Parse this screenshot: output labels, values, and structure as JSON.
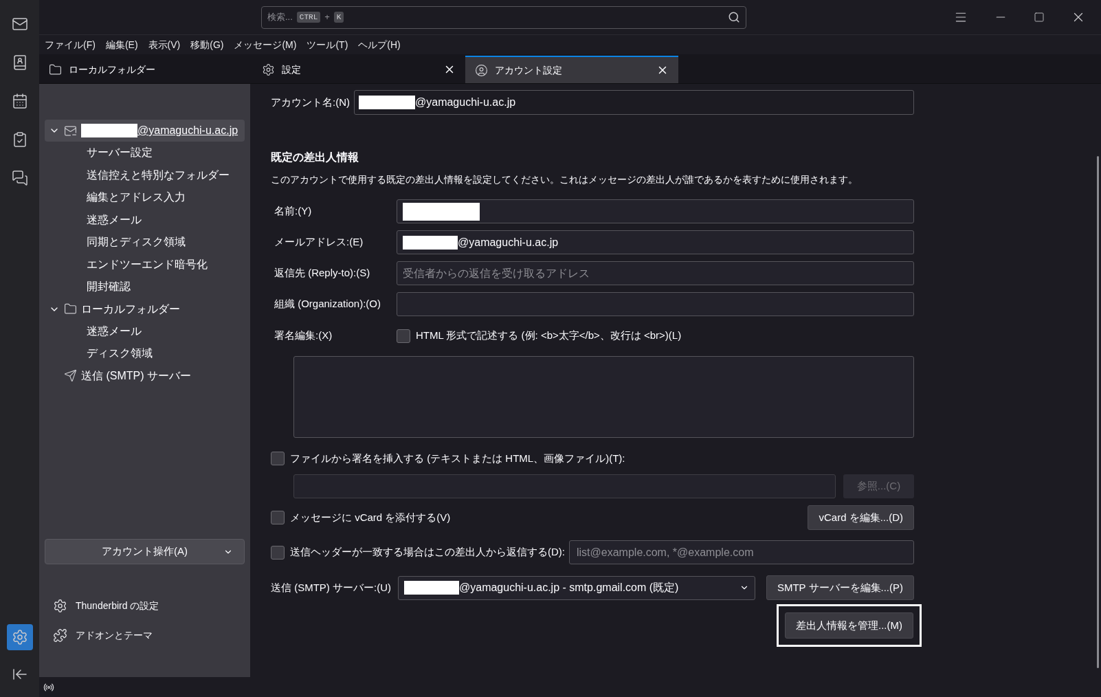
{
  "rail": [
    {
      "kind": "mail",
      "selected": false
    },
    {
      "kind": "contacts",
      "selected": false
    },
    {
      "kind": "calendar",
      "selected": false
    },
    {
      "kind": "tasks",
      "selected": false
    },
    {
      "kind": "chat",
      "selected": false
    }
  ],
  "rail_bottom": [
    {
      "kind": "settings",
      "selected": true
    },
    {
      "kind": "collapse",
      "selected": false
    }
  ],
  "search": {
    "placeholder": "検索...",
    "keys": [
      "CTRL",
      "K"
    ],
    "joiner": "+"
  },
  "menu_bar": [
    "ファイル(F)",
    "編集(E)",
    "表示(V)",
    "移動(G)",
    "メッセージ(M)",
    "ツール(T)",
    "ヘルプ(H)"
  ],
  "tabs": [
    {
      "label": "ローカルフォルダー",
      "kind": "folder",
      "selected": false,
      "closable": false
    },
    {
      "label": "設定",
      "kind": "gear",
      "selected": false,
      "closable": true
    },
    {
      "label": "アカウント設定",
      "kind": "account",
      "selected": true,
      "closable": true
    }
  ],
  "sidebar": {
    "tree": [
      {
        "label": "@yamaguchi-u.ac.jp",
        "kind": "account",
        "redacted": true,
        "expanded": true,
        "selected": true,
        "children": [
          {
            "label": "サーバー設定"
          },
          {
            "label": "送信控えと特別なフォルダー"
          },
          {
            "label": "編集とアドレス入力"
          },
          {
            "label": "迷惑メール"
          },
          {
            "label": "同期とディスク領域"
          },
          {
            "label": "エンドツーエンド暗号化"
          },
          {
            "label": "開封確認"
          }
        ]
      },
      {
        "label": "ローカルフォルダー",
        "kind": "folder",
        "redacted": false,
        "expanded": true,
        "selected": false,
        "children": [
          {
            "label": "迷惑メール"
          },
          {
            "label": "ディスク領域"
          }
        ]
      },
      {
        "label": "送信 (SMTP) サーバー",
        "kind": "smtp",
        "redacted": false,
        "selected": false
      }
    ],
    "account_actions": "アカウント操作(A)",
    "footer": [
      {
        "label": "Thunderbird の設定",
        "kind": "gear"
      },
      {
        "label": "アドオンとテーマ",
        "kind": "addons"
      }
    ]
  },
  "form": {
    "account_name": {
      "label": "アカウント名:(N)",
      "value": "@yamaguchi-u.ac.jp",
      "redacted": true
    },
    "heading": "既定の差出人情報",
    "description": "このアカウントで使用する既定の差出人情報を設定してください。これはメッセージの差出人が誰であるかを表すために使用されます。",
    "fields": [
      {
        "label": "名前:(Y)",
        "redacted": true
      },
      {
        "label": "メールアドレス:(E)",
        "value": "@yamaguchi-u.ac.jp",
        "redacted": true
      },
      {
        "label": "返信先 (Reply-to):(S)",
        "placeholder": "受信者からの返信を受け取るアドレス",
        "redacted": false
      },
      {
        "label": "組織 (Organization):(O)",
        "redacted": false
      }
    ],
    "signature": {
      "label": "署名編集:(X)",
      "html_option": {
        "label": "HTML 形式で記述する (例: <b>太字</b>、改行は <br>)(L)",
        "checked": false
      }
    },
    "file_signature": {
      "label": "ファイルから署名を挿入する (テキストまたは HTML、画像ファイル)(T):",
      "checked": false
    },
    "browse_button": {
      "label": "参照...(C)",
      "disabled": true
    },
    "vcard": {
      "label": "メッセージに vCard を添付する(V)",
      "checked": false
    },
    "vcard_button": "vCard を編集...(D)",
    "reply_header": {
      "label": "送信ヘッダーが一致する場合はこの差出人から返信する(D):",
      "checked": false,
      "placeholder": "list@example.com, *@example.com"
    },
    "smtp": {
      "label": "送信 (SMTP) サーバー:(U)",
      "value": "@yamaguchi-u.ac.jp - smtp.gmail.com (既定)",
      "redacted": true
    },
    "smtp_button": "SMTP サーバーを編集...(P)",
    "manage_button": {
      "label": "差出人情報を管理...(M)",
      "highlighted": true
    }
  }
}
